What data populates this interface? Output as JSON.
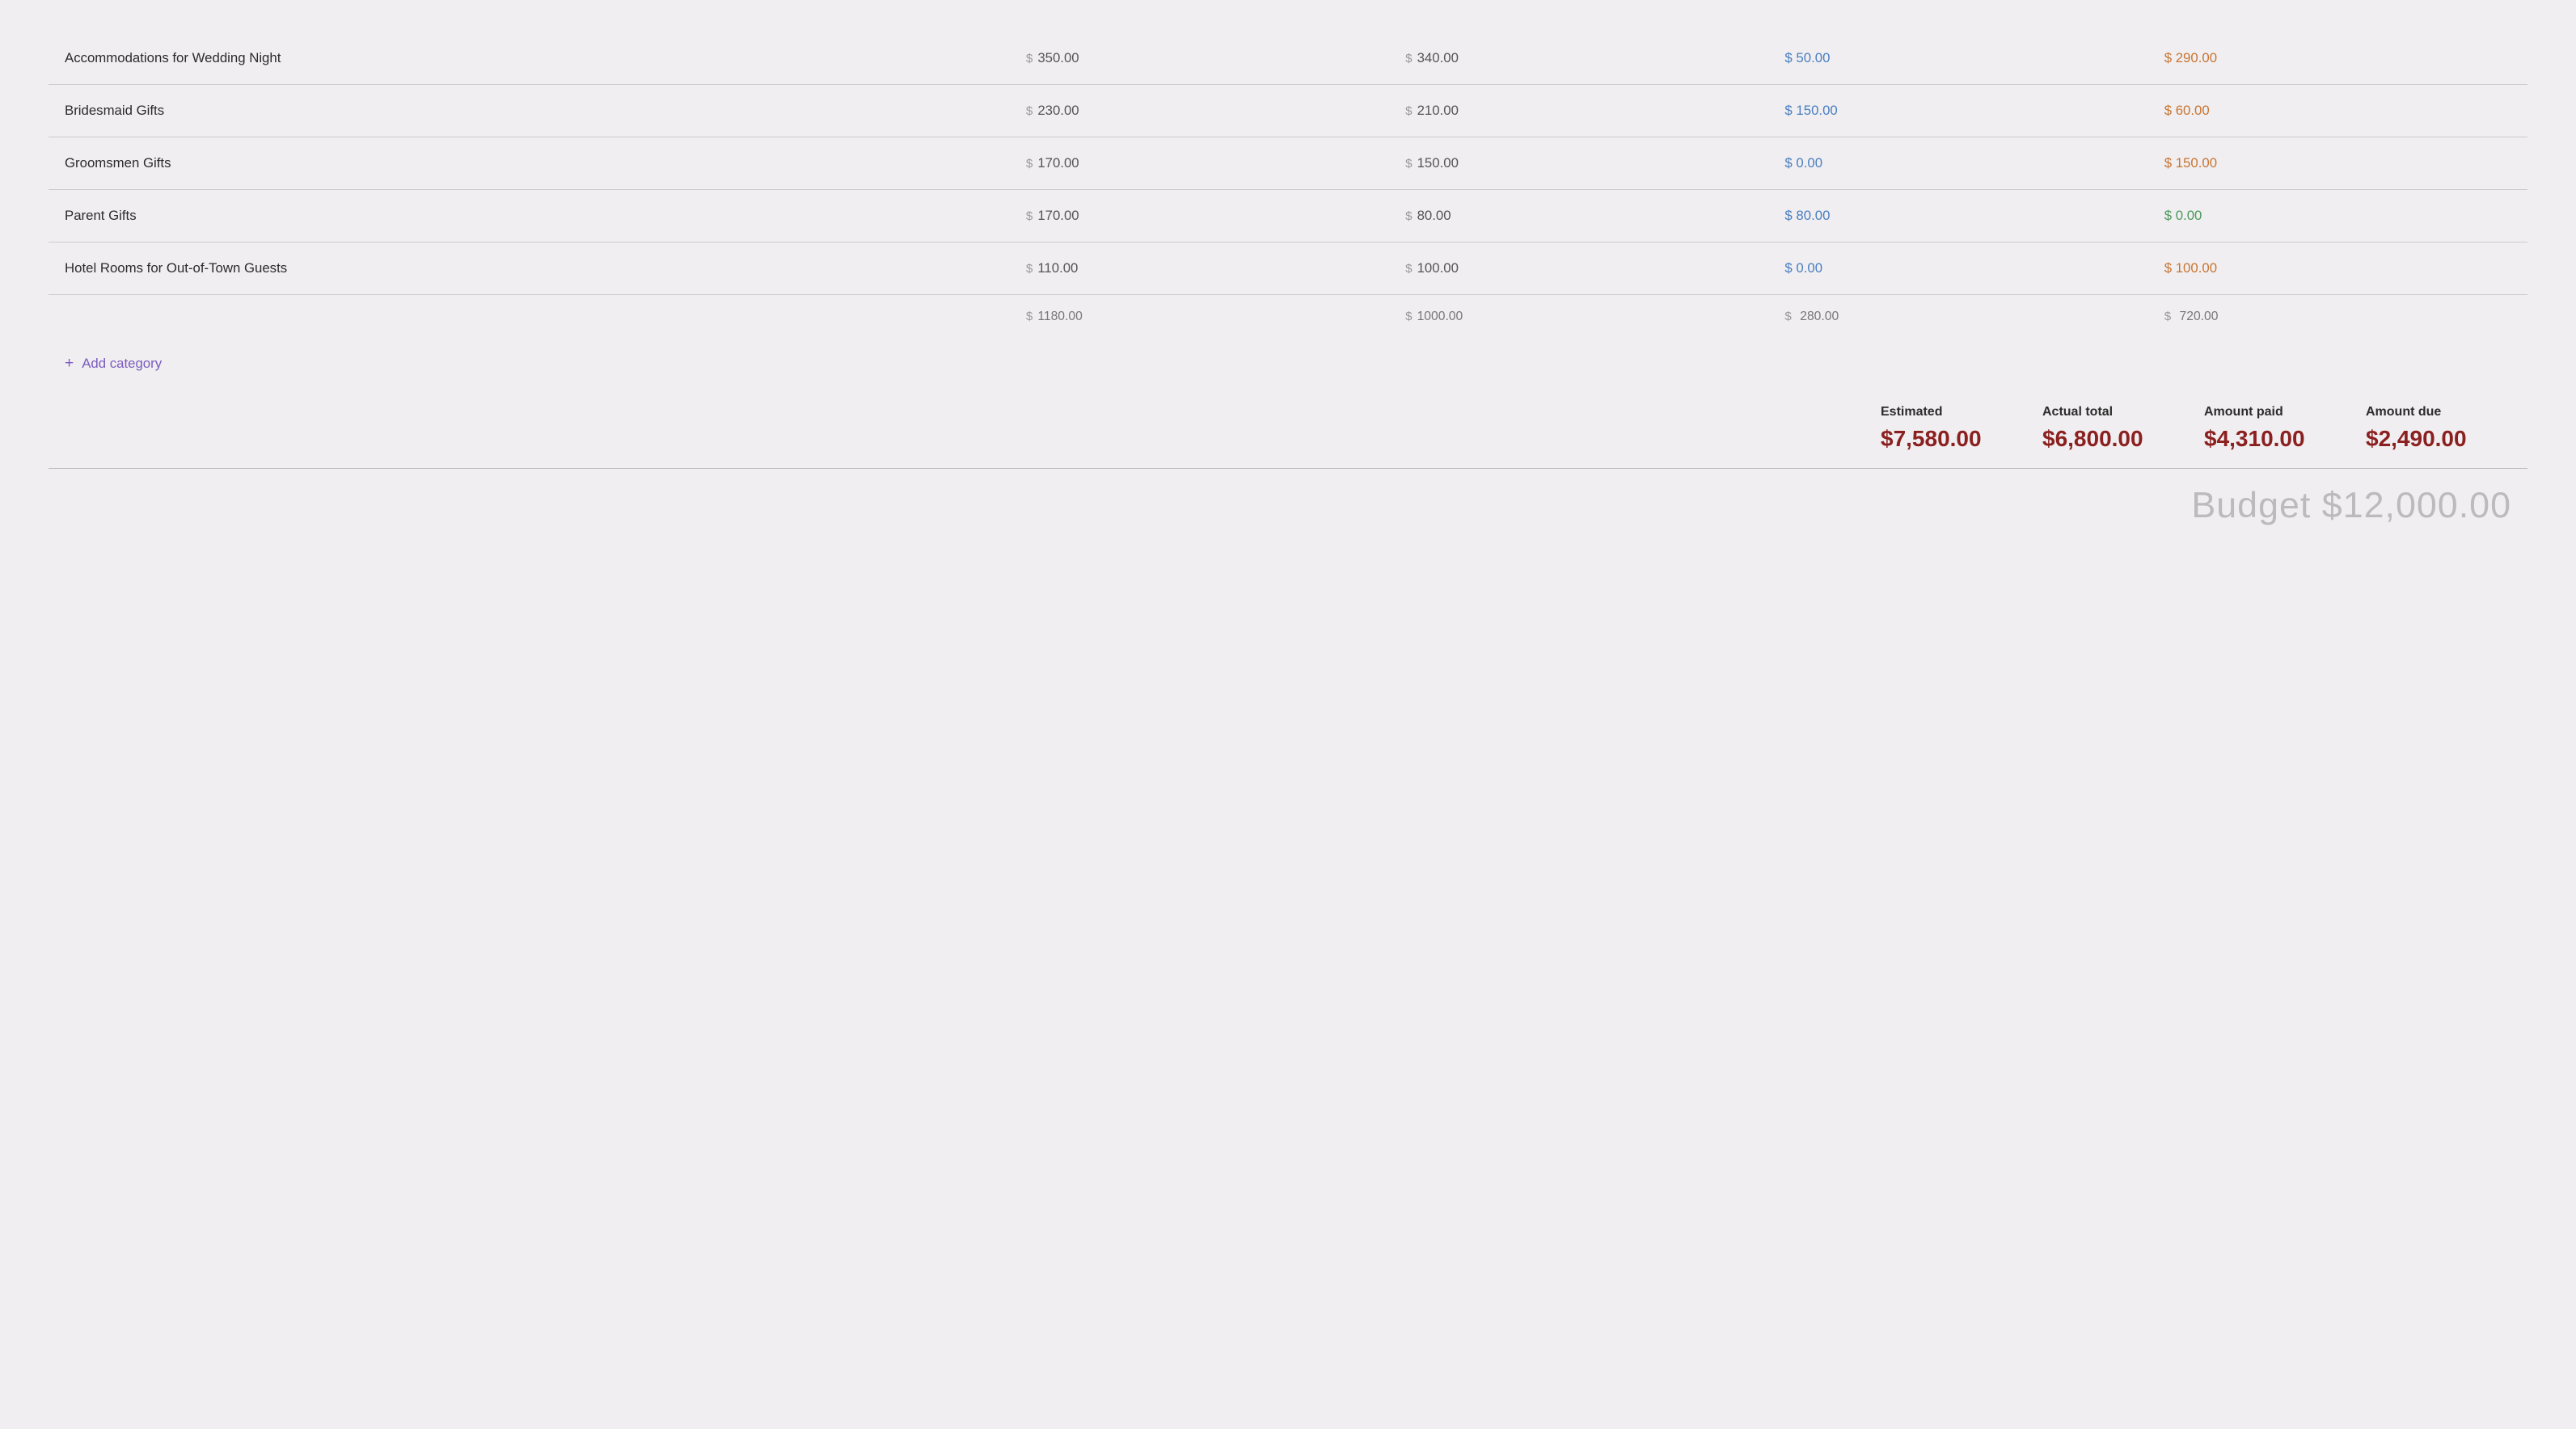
{
  "table": {
    "rows": [
      {
        "name": "Accommodations for Wedding Night",
        "estimated": "350.00",
        "actual": "340.00",
        "paid": "50.00",
        "due": "290.00",
        "paid_color": "blue",
        "due_color": "orange"
      },
      {
        "name": "Bridesmaid Gifts",
        "estimated": "230.00",
        "actual": "210.00",
        "paid": "150.00",
        "due": "60.00",
        "paid_color": "blue",
        "due_color": "orange"
      },
      {
        "name": "Groomsmen Gifts",
        "estimated": "170.00",
        "actual": "150.00",
        "paid": "0.00",
        "due": "150.00",
        "paid_color": "blue",
        "due_color": "orange"
      },
      {
        "name": "Parent Gifts",
        "estimated": "170.00",
        "actual": "80.00",
        "paid": "80.00",
        "due": "0.00",
        "paid_color": "blue",
        "due_color": "green"
      },
      {
        "name": "Hotel Rooms for Out-of-Town Guests",
        "estimated": "110.00",
        "actual": "100.00",
        "paid": "0.00",
        "due": "100.00",
        "paid_color": "blue",
        "due_color": "orange"
      }
    ],
    "totals": {
      "estimated": "1180.00",
      "actual": "1000.00",
      "paid": "280.00",
      "due": "720.00"
    }
  },
  "add_category_label": "Add category",
  "summary": {
    "columns": [
      {
        "label": "Estimated",
        "value": "$7,580.00"
      },
      {
        "label": "Actual total",
        "value": "$6,800.00"
      },
      {
        "label": "Amount paid",
        "value": "$4,310.00"
      },
      {
        "label": "Amount due",
        "value": "$2,490.00"
      }
    ]
  },
  "budget_total": "Budget $12,000.00",
  "icons": {
    "plus": "+",
    "dollar": "$"
  }
}
